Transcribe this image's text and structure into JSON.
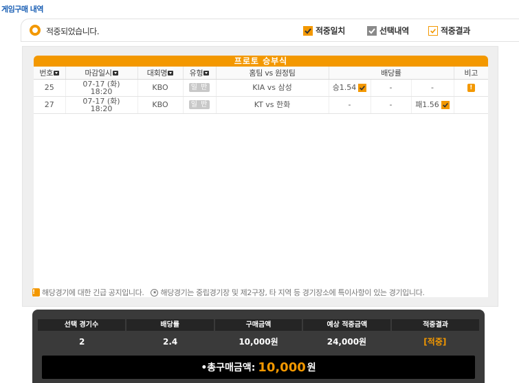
{
  "page": {
    "title": "게임구매 내역"
  },
  "status": {
    "text": "적중되었습니다."
  },
  "legend": [
    {
      "label": "적중일치",
      "color": "#f39800"
    },
    {
      "label": "선택내역",
      "color": "#8a8a8a"
    },
    {
      "label": "적중결과",
      "color": "#f39800"
    }
  ],
  "table": {
    "title": "프로토 승부식",
    "headers": {
      "no": "번호",
      "deadline": "마감일시",
      "league": "대회명",
      "type": "유형",
      "match": "홈팀 vs 원정팀",
      "odds": "배당률",
      "note": "비고"
    },
    "rows": [
      {
        "no": "25",
        "deadline_date": "07-17 (화)",
        "deadline_time": "18:20",
        "league": "KBO",
        "type": "일 반",
        "match": "KIA vs 삼성",
        "odd_win": "승1.54",
        "odd_draw": "-",
        "odd_lose": "-",
        "note_icon": "!"
      },
      {
        "no": "27",
        "deadline_date": "07-17 (화)",
        "deadline_time": "18:20",
        "league": "KBO",
        "type": "일 반",
        "match": "KT vs 한화",
        "odd_win": "-",
        "odd_draw": "-",
        "odd_lose": "패1.56",
        "note_icon": ""
      }
    ]
  },
  "notice": {
    "urgent_icon": "!",
    "urgent": "해당경기에 대한 긴급 공지입니다.",
    "neutral_icon": "★",
    "neutral": "해당경기는 중립경기장 및 제2구장, 타 지역 등 경기장소에 특이사항이 있는 경기입니다."
  },
  "summary": {
    "headers": [
      "선택 경기수",
      "배당률",
      "구매금액",
      "예상 적중금액",
      "적중결과"
    ],
    "values": [
      "2",
      "2.4",
      "10,000원",
      "24,000원",
      "[적중]"
    ],
    "total_label": "•총구매금액:",
    "total_amount": "10,000",
    "total_unit": "원"
  },
  "colors": {
    "accent": "#f39800",
    "title_blue": "#1a5fb4"
  }
}
